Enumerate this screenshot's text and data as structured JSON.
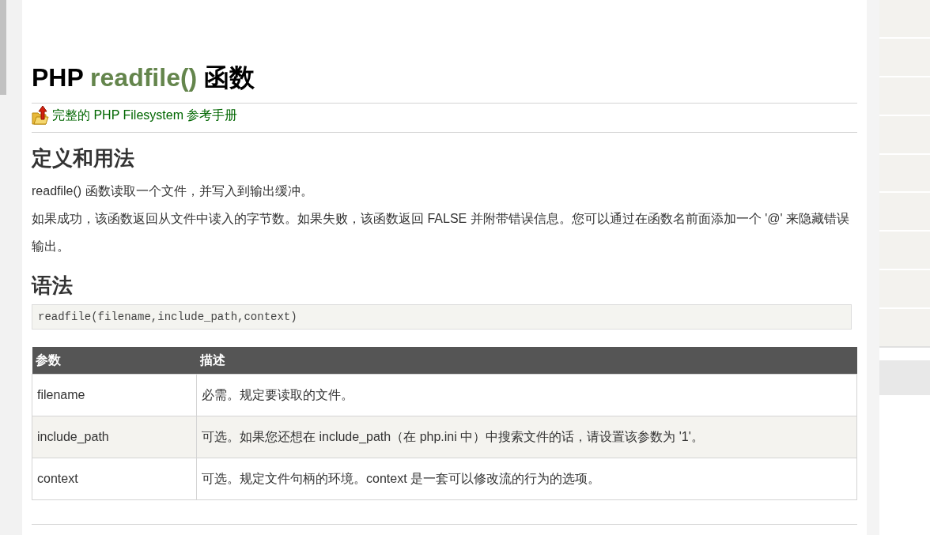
{
  "title": {
    "prefix": "PHP",
    "function": "readfile()",
    "suffix": "函数"
  },
  "reference_link": {
    "text": "完整的 PHP Filesystem 参考手册"
  },
  "sections": [
    {
      "heading": "定义和用法",
      "paragraphs": [
        "readfile() 函数读取一个文件，并写入到输出缓冲。",
        "如果成功，该函数返回从文件中读入的字节数。如果失败，该函数返回 FALSE 并附带错误信息。您可以通过在函数名前面添加一个 '@' 来隐藏错误输出。"
      ]
    },
    {
      "heading": "语法",
      "code": "readfile(filename,include_path,context)"
    }
  ],
  "table": {
    "columns": [
      "参数",
      "描述"
    ],
    "rows": [
      {
        "cells": [
          "filename",
          "必需。规定要读取的文件。"
        ],
        "shaded": false
      },
      {
        "cells": [
          "include_path",
          "可选。如果您还想在 include_path（在 php.ini 中）中搜索文件的话，请设置该参数为 '1'。"
        ],
        "shaded": true
      },
      {
        "cells": [
          "context",
          "可选。规定文件句柄的环境。context 是一套可以修改流的行为的选项。"
        ],
        "shaded": false
      }
    ]
  }
}
